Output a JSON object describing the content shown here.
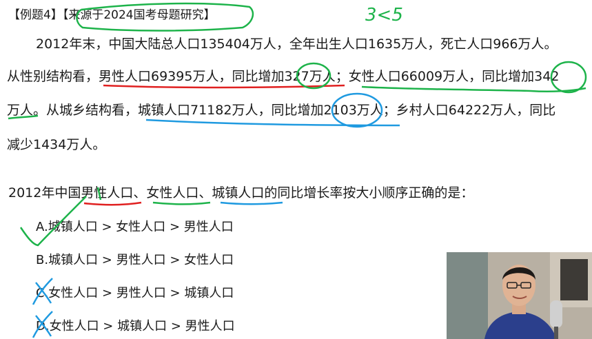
{
  "title": {
    "tag": "【例题4】",
    "source": "【来源于2024国考母题研究】"
  },
  "passage": {
    "line1": "2012年末，中国大陆总人口135404万人，全年出生人口1635万人，死亡人口966万人。",
    "line2": "从性别结构看，男性人口69395万人，同比增加327万人；女性人口66009万人，同比增加342",
    "line3": "万人。从城乡结构看，城镇人口71182万人，同比增加2103万人；乡村人口64222万人，同比",
    "line4": "减少1434万人。"
  },
  "question": "2012年中国男性人口、女性人口、城镇人口的同比增长率按大小顺序正确的是：",
  "options": {
    "a": "A.城镇人口 > 女性人口 > 男性人口",
    "b": "B.城镇人口 > 男性人口 > 女性人口",
    "c": "C.女性人口 > 男性人口 > 城镇人口",
    "d": "D.女性人口 > 城镇人口 > 男性人口"
  },
  "annotations": {
    "handwritten_note": "3<5",
    "colors": {
      "green": "#1db34a",
      "red": "#e02020",
      "blue": "#1f9ae0"
    }
  }
}
